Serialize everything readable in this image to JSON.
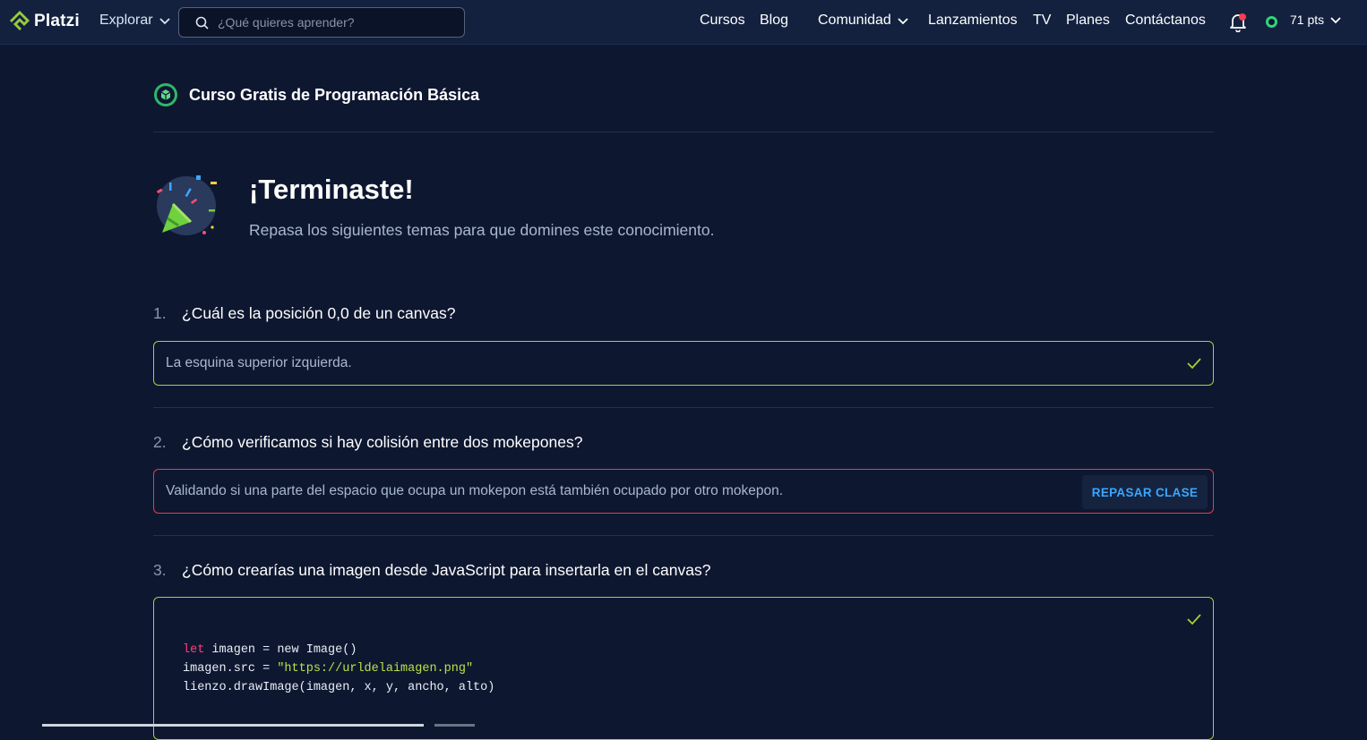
{
  "header": {
    "logo_text": "Platzi",
    "explore_label": "Explorar",
    "search_placeholder": "¿Qué quieres aprender?",
    "nav": {
      "cursos": "Cursos",
      "blog": "Blog",
      "comunidad": "Comunidad",
      "lanzamientos": "Lanzamientos",
      "tv": "TV",
      "planes": "Planes",
      "contacto": "Contáctanos"
    },
    "points": "71 pts"
  },
  "course": {
    "title": "Curso Gratis de Programación Básica"
  },
  "result": {
    "title": "¡Terminaste!",
    "subtitle": "Repasa los siguientes temas para que domines este conocimiento."
  },
  "questions": [
    {
      "number": "1.",
      "text": "¿Cuál es la posición 0,0 de un canvas?",
      "answer": "La esquina superior izquierda.",
      "status": "correct"
    },
    {
      "number": "2.",
      "text": "¿Cómo verificamos si hay colisión entre dos mokepones?",
      "answer": "Validando si una parte del espacio que ocupa un mokepon está también ocupado por otro mokepon.",
      "status": "incorrect",
      "review_label": "REPASAR CLASE"
    },
    {
      "number": "3.",
      "text": "¿Cómo crearías una imagen desde JavaScript para insertarla en el canvas?",
      "status": "correct",
      "code": {
        "line1_kw": "let",
        "line1_rest": " imagen = new Image()",
        "line2_pre": "imagen.src = ",
        "line2_str": "\"https://urldelaimagen.png\"",
        "line3": "lienzo.drawImage(imagen, x, y, ancho, alto)"
      }
    }
  ],
  "colors": {
    "background": "#0e1730",
    "header": "#13213f",
    "correct": "#a8d136",
    "incorrect": "#e33d4c",
    "link": "#3aa7ff",
    "brand_green": "#98ca3f"
  }
}
